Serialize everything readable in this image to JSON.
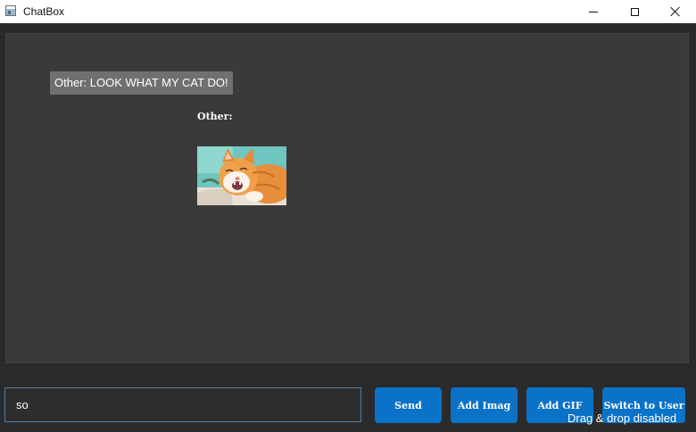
{
  "window": {
    "title": "ChatBox",
    "controls": [
      "minimize-icon",
      "maximize-icon",
      "close-icon"
    ]
  },
  "chat": {
    "messages": [
      {
        "type": "text",
        "text": "Other: LOOK WHAT MY CAT DO!"
      },
      {
        "type": "image",
        "sender_label": "Other:",
        "image_subject": "cat"
      }
    ]
  },
  "composer": {
    "input_value": "so",
    "buttons": {
      "send": "Send",
      "add_image": "Add Imag",
      "add_gif": "Add GIF",
      "switch_user": "Switch to User"
    },
    "status": "Drag & drop disabled"
  },
  "colors": {
    "accent": "#0a73c8",
    "chat_background": "#3a3a3a",
    "bubble": "#707070"
  }
}
